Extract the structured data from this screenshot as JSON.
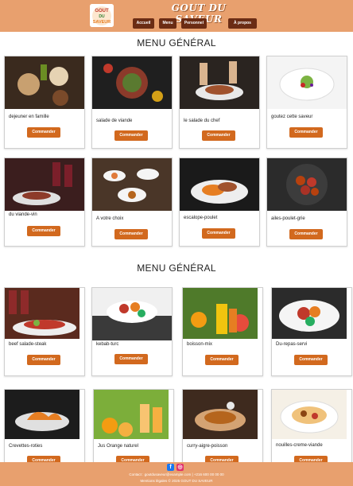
{
  "header": {
    "site_title": "GOUT DU SAVEUR",
    "logo_top": "GOUT",
    "logo_mid": "DU",
    "logo_bottom": "SAVEUR",
    "nav": [
      "Accueil",
      "Menu",
      "Personnel",
      "À propos"
    ]
  },
  "sections": [
    {
      "title": "MENU GÉNÉRAL",
      "rows": [
        [
          {
            "name": "dejeuner en famille",
            "button": "Commander"
          },
          {
            "name": "salade de viande",
            "button": "Commander"
          },
          {
            "name": "le salade du chef",
            "button": "Commander"
          },
          {
            "name": "goutez cette saveur",
            "button": "Commander"
          }
        ],
        [
          {
            "name": "du viande-vin",
            "button": "Commander"
          },
          {
            "name": "A votre choix",
            "button": "Commander"
          },
          {
            "name": "escalope-poulet",
            "button": "Commander"
          },
          {
            "name": "ailes-poulet-grie",
            "button": "Commander"
          }
        ]
      ]
    },
    {
      "title": "MENU GÉNÉRAL",
      "rows": [
        [
          {
            "name": "beef salade-steak",
            "button": "Commander"
          },
          {
            "name": "kebab-turc",
            "button": "Commander"
          },
          {
            "name": "boisson-mix",
            "button": "Commander"
          },
          {
            "name": "Du-repas-servi",
            "button": "Commander"
          }
        ],
        [
          {
            "name": "Crevettes-roties",
            "button": "Commander"
          },
          {
            "name": "Jus Orange naturel",
            "button": "Commander"
          },
          {
            "name": "curry-aigre-poisson",
            "button": "Commander"
          },
          {
            "name": "nouilles-creme-viande",
            "button": "Commander"
          }
        ]
      ]
    }
  ],
  "footer": {
    "contact": "Contact : goutdusaveur@example.com | +216 600 00 00 00",
    "legal": "Mentions légales © 2025 GOUT DU SAVEUR",
    "facebook_icon": "facebook-icon",
    "instagram_icon": "instagram-icon"
  },
  "colors": {
    "header_bg": "#e8a06e",
    "nav_button": "#6b2c14",
    "order_button": "#d2691e"
  }
}
